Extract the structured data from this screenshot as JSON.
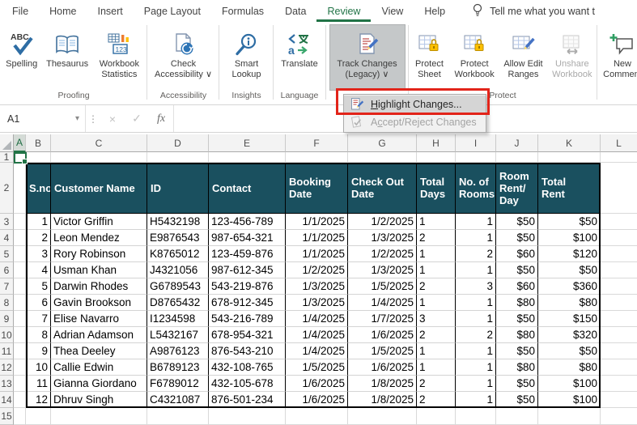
{
  "ribbon": {
    "tabs": [
      {
        "id": "file",
        "label": "File",
        "active": false
      },
      {
        "id": "home",
        "label": "Home",
        "active": false
      },
      {
        "id": "insert",
        "label": "Insert",
        "active": false
      },
      {
        "id": "page-layout",
        "label": "Page Layout",
        "active": false
      },
      {
        "id": "formulas",
        "label": "Formulas",
        "active": false
      },
      {
        "id": "data",
        "label": "Data",
        "active": false
      },
      {
        "id": "review",
        "label": "Review",
        "active": true
      },
      {
        "id": "view",
        "label": "View",
        "active": false
      },
      {
        "id": "help",
        "label": "Help",
        "active": false
      }
    ],
    "tell_me": "Tell me what you want t",
    "groups": [
      {
        "id": "proofing",
        "label": "Proofing",
        "buttons": [
          {
            "id": "spelling",
            "label": "Spelling",
            "icon": "spelling-icon"
          },
          {
            "id": "thesaurus",
            "label": "Thesaurus",
            "icon": "thesaurus-icon"
          },
          {
            "id": "workbook-statistics",
            "label": "Workbook\nStatistics",
            "icon": "workbook-statistics-icon"
          }
        ]
      },
      {
        "id": "accessibility",
        "label": "Accessibility",
        "buttons": [
          {
            "id": "check-accessibility",
            "label": "Check\nAccessibility ∨",
            "icon": "check-accessibility-icon"
          }
        ]
      },
      {
        "id": "insights",
        "label": "Insights",
        "buttons": [
          {
            "id": "smart-lookup",
            "label": "Smart\nLookup",
            "icon": "smart-lookup-icon"
          }
        ]
      },
      {
        "id": "language",
        "label": "Language",
        "buttons": [
          {
            "id": "translate",
            "label": "Translate",
            "icon": "translate-icon"
          }
        ]
      },
      {
        "id": "changes",
        "label": "",
        "buttons": [
          {
            "id": "track-changes",
            "label": "Track Changes\n(Legacy) ∨",
            "icon": "track-changes-icon",
            "pressed": true
          }
        ]
      },
      {
        "id": "protect",
        "label": "Protect",
        "buttons": [
          {
            "id": "protect-sheet",
            "label": "Protect\nSheet",
            "icon": "protect-sheet-icon"
          },
          {
            "id": "protect-workbook",
            "label": "Protect\nWorkbook",
            "icon": "protect-workbook-icon"
          },
          {
            "id": "allow-edit-ranges",
            "label": "Allow Edit\nRanges",
            "icon": "allow-edit-ranges-icon"
          },
          {
            "id": "unshare-workbook",
            "label": "Unshare\nWorkbook",
            "icon": "unshare-workbook-icon",
            "disabled": true
          }
        ]
      },
      {
        "id": "comments",
        "label": "",
        "buttons": [
          {
            "id": "new-comment",
            "label": "New\nComment",
            "icon": "new-comment-icon"
          }
        ]
      }
    ]
  },
  "dropdown_menu": {
    "items": [
      {
        "id": "highlight-changes",
        "label": "Highlight Changes...",
        "accel": "H",
        "icon": "highlight-changes-icon",
        "enabled": true,
        "highlighted": true
      },
      {
        "id": "accept-reject-changes",
        "label": "Accept/Reject Changes",
        "accel": "c",
        "icon": "accept-reject-icon",
        "enabled": false,
        "highlighted": false
      }
    ]
  },
  "formula_bar": {
    "name_box": "A1",
    "name_box_arrow": "▾",
    "dots": "⋮",
    "cancel_glyph": "×",
    "enter_glyph": "✓",
    "fx_label": "fx",
    "formula": ""
  },
  "sheet": {
    "selected_cell": "A1",
    "col_letters": [
      "A",
      "B",
      "C",
      "D",
      "E",
      "F",
      "G",
      "H",
      "I",
      "J",
      "K",
      "L"
    ],
    "row_numbers": [
      "1",
      "2",
      "3",
      "4",
      "5",
      "6",
      "7",
      "8",
      "9",
      "10",
      "11",
      "12",
      "13",
      "14",
      "15"
    ],
    "table": {
      "headers": [
        "S.no",
        "Customer Name",
        "ID",
        "Contact",
        "Booking\nDate",
        "Check Out\nDate",
        "Total\nDays",
        "No. of\nRooms",
        "Room\nRent/\nDay",
        "Total\nRent"
      ],
      "rows": [
        [
          "1",
          "Victor Griffin",
          "H5432198",
          "123-456-789",
          "1/1/2025",
          "1/2/2025",
          "1",
          "1",
          "$50",
          "$50"
        ],
        [
          "2",
          "Leon Mendez",
          "E9876543",
          "987-654-321",
          "1/1/2025",
          "1/3/2025",
          "2",
          "1",
          "$50",
          "$100"
        ],
        [
          "3",
          "Rory Robinson",
          "K8765012",
          "123-459-876",
          "1/1/2025",
          "1/2/2025",
          "1",
          "2",
          "$60",
          "$120"
        ],
        [
          "4",
          "Usman Khan",
          "J4321056",
          "987-612-345",
          "1/2/2025",
          "1/3/2025",
          "1",
          "1",
          "$50",
          "$50"
        ],
        [
          "5",
          "Darwin Rhodes",
          "G6789543",
          "543-219-876",
          "1/3/2025",
          "1/5/2025",
          "2",
          "3",
          "$60",
          "$360"
        ],
        [
          "6",
          "Gavin Brookson",
          "D8765432",
          "678-912-345",
          "1/3/2025",
          "1/4/2025",
          "1",
          "1",
          "$80",
          "$80"
        ],
        [
          "7",
          "Elise Navarro",
          "I1234598",
          "543-216-789",
          "1/4/2025",
          "1/7/2025",
          "3",
          "1",
          "$50",
          "$150"
        ],
        [
          "8",
          "Adrian Adamson",
          "L5432167",
          "678-954-321",
          "1/4/2025",
          "1/6/2025",
          "2",
          "2",
          "$80",
          "$320"
        ],
        [
          "9",
          "Thea Deeley",
          "A9876123",
          "876-543-210",
          "1/4/2025",
          "1/5/2025",
          "1",
          "1",
          "$50",
          "$50"
        ],
        [
          "10",
          "Callie Edwin",
          "B6789123",
          "432-108-765",
          "1/5/2025",
          "1/6/2025",
          "1",
          "1",
          "$80",
          "$80"
        ],
        [
          "11",
          "Gianna Giordano",
          "F6789012",
          "432-105-678",
          "1/6/2025",
          "1/8/2025",
          "2",
          "1",
          "$50",
          "$100"
        ],
        [
          "12",
          "Dhruv Singh",
          "C4321087",
          "876-501-234",
          "1/6/2025",
          "1/8/2025",
          "2",
          "1",
          "$50",
          "$100"
        ]
      ]
    }
  },
  "colors": {
    "accent_green": "#217346",
    "table_header_fill": "#1A505F",
    "annotation_red": "#E2241A",
    "pressed_button_bg": "#C5C8C9"
  }
}
